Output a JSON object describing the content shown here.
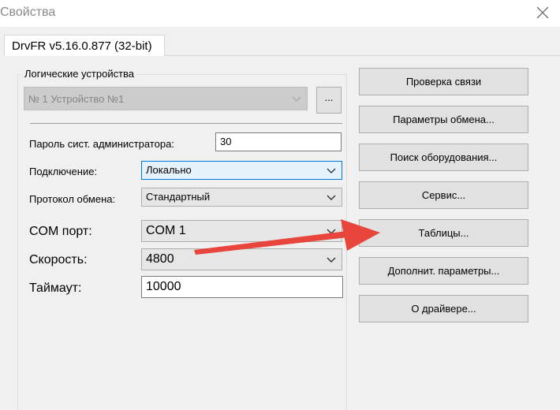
{
  "window": {
    "title": "Свойства"
  },
  "tab": {
    "label": "DrvFR v5.16.0.877 (32-bit)"
  },
  "group": {
    "title": "Логические устройства"
  },
  "device": {
    "value": "№ 1 Устройство №1",
    "browse_label": "..."
  },
  "fields": {
    "password": {
      "label": "Пароль сист. администратора:",
      "value": "30"
    },
    "connection": {
      "label": "Подключение:",
      "value": "Локально"
    },
    "protocol": {
      "label": "Протокол обмена:",
      "value": "Стандартный"
    },
    "com_port": {
      "label": "COM порт:",
      "value": "COM 1"
    },
    "speed": {
      "label": "Скорость:",
      "value": "4800"
    },
    "timeout": {
      "label": "Таймаут:",
      "value": "10000"
    }
  },
  "buttons": {
    "check_connection": "Проверка связи",
    "exchange_params": "Параметры обмена...",
    "search_equipment": "Поиск оборудования...",
    "service": "Сервис...",
    "tables": "Таблицы...",
    "additional_params": "Дополнит. параметры...",
    "about_driver": "О драйвере..."
  },
  "colors": {
    "focus_border": "#0078d7",
    "annotation_arrow": "#e8453c"
  },
  "icons": [
    "close-icon",
    "chevron-down-icon",
    "annotation-arrow"
  ]
}
